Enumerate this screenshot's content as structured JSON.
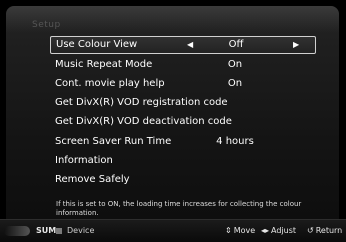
{
  "menu": {
    "items": [
      {
        "label": "Use Colour View",
        "value": "Off",
        "selected": true
      },
      {
        "label": "Music Repeat Mode",
        "value": "On"
      },
      {
        "label": "Cont. movie play help",
        "value": "On"
      },
      {
        "label": "Get DivX(R) VOD registration code",
        "value": ""
      },
      {
        "label": "Get DivX(R) VOD deactivation code",
        "value": ""
      },
      {
        "label": "Screen Saver Run Time",
        "value": "4 hours"
      },
      {
        "label": "Information",
        "value": ""
      },
      {
        "label": "Remove Safely",
        "value": ""
      }
    ],
    "left_arrow_glyph": "◀",
    "right_arrow_glyph": "▶"
  },
  "help_text": "If this is set to ON, the loading time increases for collecting the colour information.",
  "footer": {
    "sum_label": "SUM",
    "device_label": "Device",
    "move_icon": "⇕",
    "move_label": "Move",
    "adjust_icon": "◂▸",
    "adjust_label": "Adjust",
    "return_icon": "↺",
    "return_label": "Return"
  }
}
